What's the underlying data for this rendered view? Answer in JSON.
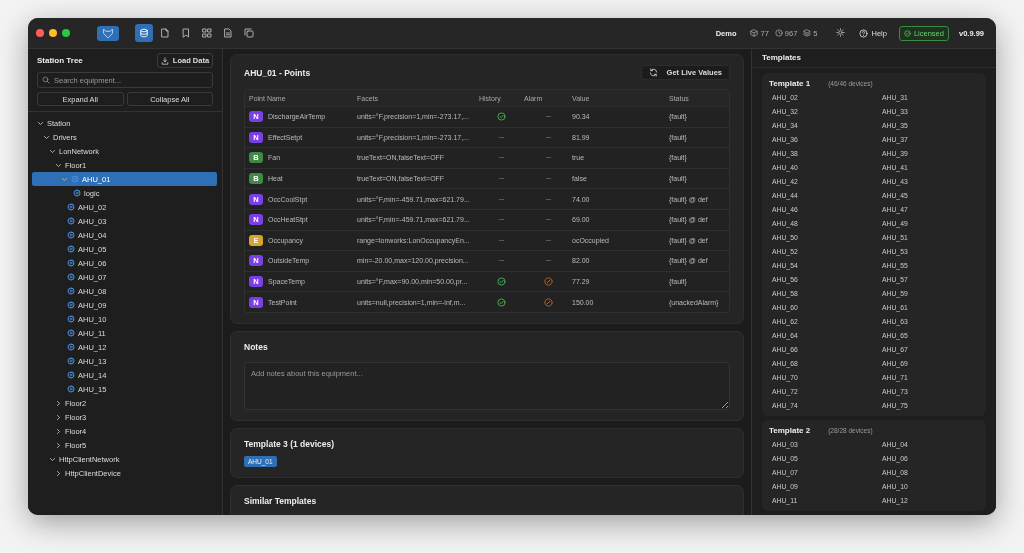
{
  "toolbar": [
    {
      "selected": true
    },
    {
      "selected": false
    },
    {
      "selected": false
    },
    {
      "selected": false
    },
    {
      "selected": false
    },
    {
      "selected": false
    }
  ],
  "top_bar": {
    "project": "Demo",
    "stats": [
      "77",
      "967",
      "5"
    ],
    "help": "Help",
    "license": "Licensed",
    "version": "v0.9.99"
  },
  "sidebar": {
    "title": "Station Tree",
    "load_button": "Load Data",
    "search": {
      "placeholder": "Search equipment..."
    },
    "buttons": [
      "Expand All",
      "Collapse All"
    ],
    "tree": [
      {
        "label": "Station",
        "expanded": true,
        "selected": false,
        "children": [
          {
            "label": "Drivers",
            "expanded": true,
            "selected": false,
            "children": [
              {
                "label": "LonNetwork",
                "expanded": true,
                "selected": false,
                "children": [
                  {
                    "label": "Floor1",
                    "expanded": true,
                    "selected": false,
                    "children": [
                      {
                        "label": "AHU_01",
                        "kind": "device",
                        "expanded": true,
                        "selected": true,
                        "children": [
                          {
                            "label": "logic",
                            "kind": "device",
                            "selected": false
                          }
                        ]
                      },
                      {
                        "label": "AHU_02",
                        "kind": "device",
                        "selected": false
                      },
                      {
                        "label": "AHU_03",
                        "kind": "device",
                        "selected": false
                      },
                      {
                        "label": "AHU_04",
                        "kind": "device",
                        "selected": false
                      },
                      {
                        "label": "AHU_05",
                        "kind": "device",
                        "selected": false
                      },
                      {
                        "label": "AHU_06",
                        "kind": "device",
                        "selected": false
                      },
                      {
                        "label": "AHU_07",
                        "kind": "device",
                        "selected": false
                      },
                      {
                        "label": "AHU_08",
                        "kind": "device",
                        "selected": false
                      },
                      {
                        "label": "AHU_09",
                        "kind": "device",
                        "selected": false
                      },
                      {
                        "label": "AHU_10",
                        "kind": "device",
                        "selected": false
                      },
                      {
                        "label": "AHU_11",
                        "kind": "device",
                        "selected": false
                      },
                      {
                        "label": "AHU_12",
                        "kind": "device",
                        "selected": false
                      },
                      {
                        "label": "AHU_13",
                        "kind": "device",
                        "selected": false
                      },
                      {
                        "label": "AHU_14",
                        "kind": "device",
                        "selected": false
                      },
                      {
                        "label": "AHU_15",
                        "kind": "device",
                        "selected": false
                      }
                    ]
                  },
                  {
                    "label": "Floor2",
                    "expanded": false,
                    "selected": false
                  },
                  {
                    "label": "Floor3",
                    "expanded": false,
                    "selected": false
                  },
                  {
                    "label": "Floor4",
                    "expanded": false,
                    "selected": false
                  },
                  {
                    "label": "Floor5",
                    "expanded": false,
                    "selected": false
                  }
                ]
              },
              {
                "label": "HttpClientNetwork",
                "expanded": true,
                "selected": false,
                "children": [
                  {
                    "label": "HttpClientDevice",
                    "expanded": false,
                    "selected": false
                  }
                ]
              }
            ]
          }
        ]
      }
    ]
  },
  "points": {
    "title": "AHU_01 - Points",
    "live_button": "Get Live Values",
    "columns": [
      "Point Name",
      "Facets",
      "History",
      "Alarm",
      "Value",
      "Status"
    ],
    "rows": [
      {
        "kind": "numeric",
        "badge": "N",
        "name": "DischargeAirTemp",
        "facets": "units=°F,precision=1,min=-273.17,...",
        "history": true,
        "alarm": false,
        "value": "90.34",
        "status": "{fault}"
      },
      {
        "kind": "numeric",
        "badge": "N",
        "name": "EffectSetpt",
        "facets": "units=°F,precision=1,min=-273.17,...",
        "history": false,
        "alarm": false,
        "value": "81.99",
        "status": "{fault}"
      },
      {
        "kind": "boolean",
        "badge": "B",
        "name": "Fan",
        "facets": "trueText=ON,falseText=OFF",
        "history": false,
        "alarm": false,
        "value": "true",
        "status": "{fault}"
      },
      {
        "kind": "boolean",
        "badge": "B",
        "name": "Heat",
        "facets": "trueText=ON,falseText=OFF",
        "history": false,
        "alarm": false,
        "value": "false",
        "status": "{fault}"
      },
      {
        "kind": "numeric",
        "badge": "N",
        "name": "OccCoolStpt",
        "facets": "units=°F,min=-459.71,max=621.79...",
        "history": false,
        "alarm": false,
        "value": "74.00",
        "status": "{fault} @ def"
      },
      {
        "kind": "numeric",
        "badge": "N",
        "name": "OccHeatStpt",
        "facets": "units=°F,min=-459.71,max=621.79...",
        "history": false,
        "alarm": false,
        "value": "69.00",
        "status": "{fault} @ def"
      },
      {
        "kind": "enum",
        "badge": "E",
        "name": "Occupancy",
        "facets": "range=lonworks:LonOccupancyEn...",
        "history": false,
        "alarm": false,
        "value": "ocOccupied",
        "status": "{fault} @ def"
      },
      {
        "kind": "numeric",
        "badge": "N",
        "name": "OutsideTemp",
        "facets": "min=-20.00,max=120.00,precision...",
        "history": false,
        "alarm": false,
        "value": "82.00",
        "status": "{fault} @ def"
      },
      {
        "kind": "numeric",
        "badge": "N",
        "name": "SpaceTemp",
        "facets": "units=°F,max=90.00,min=50.00,pr...",
        "history": true,
        "alarm": true,
        "value": "77.29",
        "status": "{fault}"
      },
      {
        "kind": "numeric",
        "badge": "N",
        "name": "TestPoint",
        "facets": "units=null,precision=1,min=-inf,m...",
        "history": true,
        "alarm": true,
        "value": "150.00",
        "status": "{unackedAlarm}"
      }
    ]
  },
  "notes": {
    "title": "Notes",
    "placeholder": "Add notes about this equipment..."
  },
  "current_template": {
    "title": "Template 3 (1 devices)",
    "devices": [
      "AHU_01"
    ]
  },
  "similar_templates": {
    "title": "Similar Templates"
  },
  "templates_panel": {
    "title": "Templates",
    "templates": [
      {
        "name": "Template 1",
        "count": "(46/46 devices)",
        "devices": [
          "AHU_02",
          "AHU_31",
          "AHU_32",
          "AHU_33",
          "AHU_34",
          "AHU_35",
          "AHU_36",
          "AHU_37",
          "AHU_38",
          "AHU_39",
          "AHU_40",
          "AHU_41",
          "AHU_42",
          "AHU_43",
          "AHU_44",
          "AHU_45",
          "AHU_46",
          "AHU_47",
          "AHU_48",
          "AHU_49",
          "AHU_50",
          "AHU_51",
          "AHU_52",
          "AHU_53",
          "AHU_54",
          "AHU_55",
          "AHU_56",
          "AHU_57",
          "AHU_58",
          "AHU_59",
          "AHU_60",
          "AHU_61",
          "AHU_62",
          "AHU_63",
          "AHU_64",
          "AHU_65",
          "AHU_66",
          "AHU_67",
          "AHU_68",
          "AHU_69",
          "AHU_70",
          "AHU_71",
          "AHU_72",
          "AHU_73",
          "AHU_74",
          "AHU_75"
        ]
      },
      {
        "name": "Template 2",
        "count": "(28/28 devices)",
        "devices": [
          "AHU_03",
          "AHU_04",
          "AHU_05",
          "AHU_06",
          "AHU_07",
          "AHU_08",
          "AHU_09",
          "AHU_10",
          "AHU_11",
          "AHU_12"
        ]
      }
    ]
  }
}
